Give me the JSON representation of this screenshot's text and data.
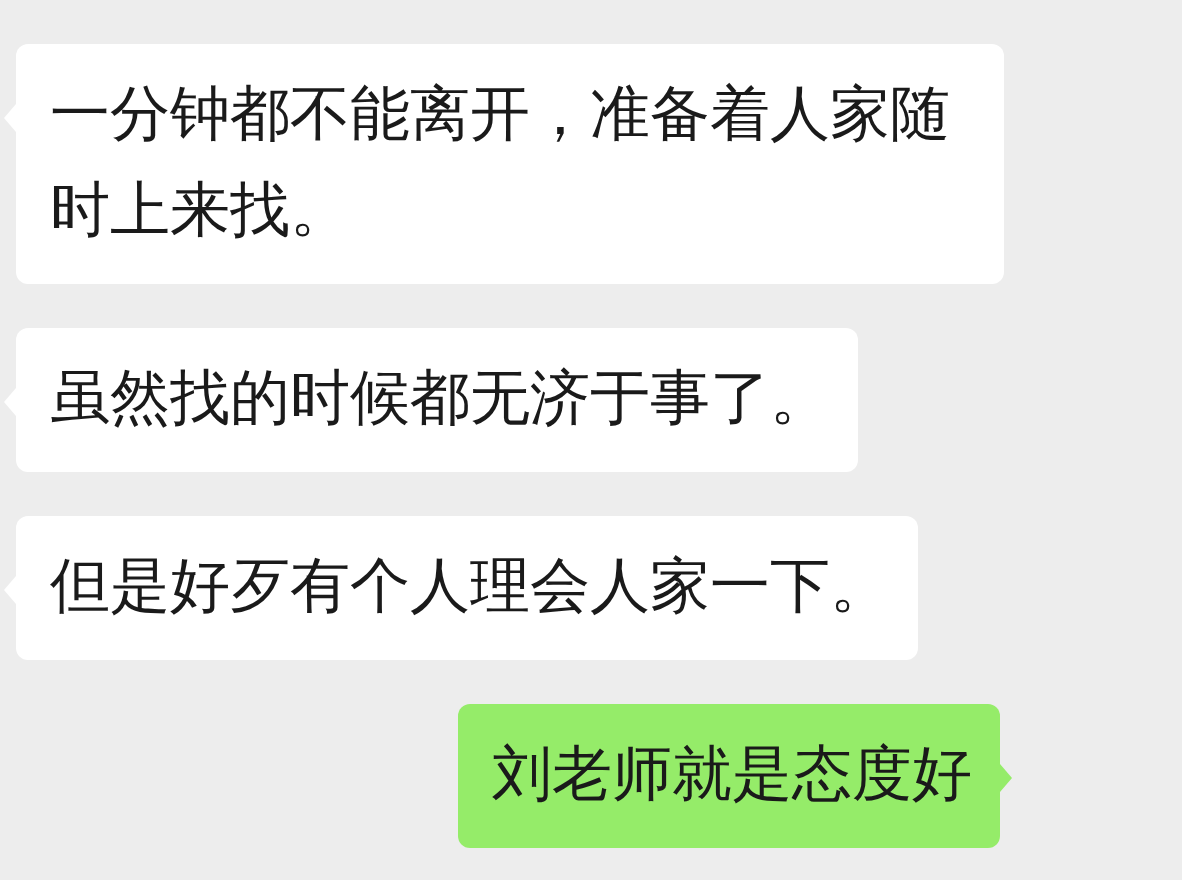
{
  "messages": [
    {
      "kind": "received",
      "text": "一分钟都不能离开，准备着人家随时上来找。"
    },
    {
      "kind": "received",
      "text": "虽然找的时候都无济于事了。"
    },
    {
      "kind": "received",
      "text": "但是好歹有个人理会人家一下。"
    },
    {
      "kind": "sent",
      "text": "刘老师就是态度好"
    }
  ]
}
